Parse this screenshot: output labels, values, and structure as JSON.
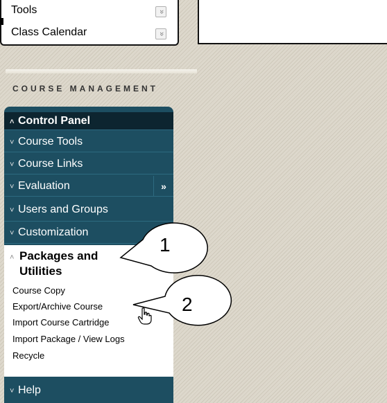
{
  "top_panel": {
    "items": [
      {
        "label": "Tools",
        "chevron": "»"
      },
      {
        "label": "Class Calendar",
        "chevron": "»"
      }
    ]
  },
  "section_title": "COURSE MANAGEMENT",
  "menu": {
    "control_panel": "Control Panel",
    "items": [
      "Course Tools",
      "Course Links",
      "Evaluation",
      "Users and Groups",
      "Customization"
    ],
    "evaluation_expand": "»",
    "open_section": {
      "title_line1": "Packages and",
      "title_line2": "Utilities",
      "subitems": [
        "Course Copy",
        "Export/Archive Course",
        "Import Course Cartridge",
        "Import Package / View Logs",
        "Recycle"
      ]
    },
    "help": "Help"
  },
  "callouts": {
    "one": "1",
    "two": "2"
  },
  "icons": {
    "collapsed": "chevron-double-down-icon",
    "expanded": "chevron-double-up-icon",
    "expand": "double-right-arrow-icon",
    "cursor": "hand-cursor-icon"
  }
}
